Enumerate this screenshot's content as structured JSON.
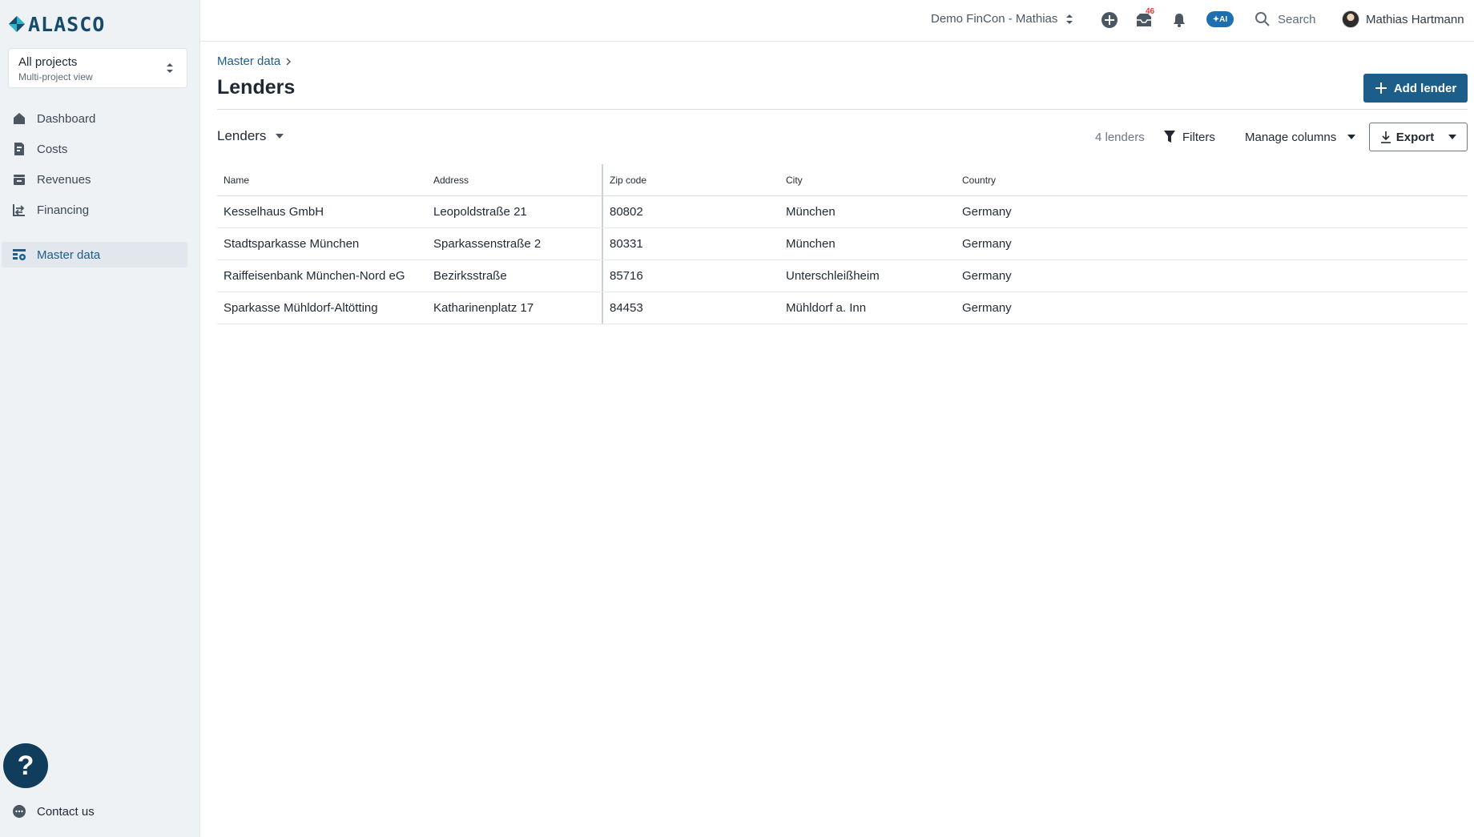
{
  "app": {
    "logo_text": "ALASCO"
  },
  "project_select": {
    "title": "All projects",
    "subtitle": "Multi-project view"
  },
  "nav": {
    "items": [
      {
        "label": "Dashboard",
        "icon": "home-icon"
      },
      {
        "label": "Costs",
        "icon": "costs-icon"
      },
      {
        "label": "Revenues",
        "icon": "revenues-icon"
      },
      {
        "label": "Financing",
        "icon": "financing-icon"
      }
    ],
    "active": {
      "label": "Master data",
      "icon": "master-data-icon"
    }
  },
  "help": {
    "label": "?"
  },
  "contact": {
    "label": "Contact us"
  },
  "topbar": {
    "org": "Demo FinCon - Mathias",
    "inbox_badge": "46",
    "ai_label": "✦AI",
    "search": "Search",
    "user": "Mathias Hartmann"
  },
  "breadcrumb": {
    "parent": "Master data"
  },
  "page": {
    "title": "Lenders",
    "add_button": "Add lender"
  },
  "toolbar": {
    "view": "Lenders",
    "count": "4 lenders",
    "filters": "Filters",
    "manage_columns": "Manage columns",
    "export": "Export"
  },
  "table": {
    "columns": [
      "Name",
      "Address",
      "Zip code",
      "City",
      "Country"
    ],
    "rows": [
      [
        "Kesselhaus GmbH",
        "Leopoldstraße 21",
        "80802",
        "München",
        "Germany"
      ],
      [
        "Stadtsparkasse München",
        "Sparkassenstraße 2",
        "80331",
        "München",
        "Germany"
      ],
      [
        "Raiffeisenbank München-Nord eG",
        "Bezirksstraße",
        "85716",
        "Unterschleißheim",
        "Germany"
      ],
      [
        "Sparkasse Mühldorf-Altötting",
        "Katharinenplatz 17",
        "84453",
        "Mühldorf a. Inn",
        "Germany"
      ]
    ]
  },
  "colors": {
    "brand": "#1c5d8a",
    "sidebar_bg": "#eef2f5",
    "help_bg": "#0f3d5b",
    "badge": "#e53935"
  }
}
